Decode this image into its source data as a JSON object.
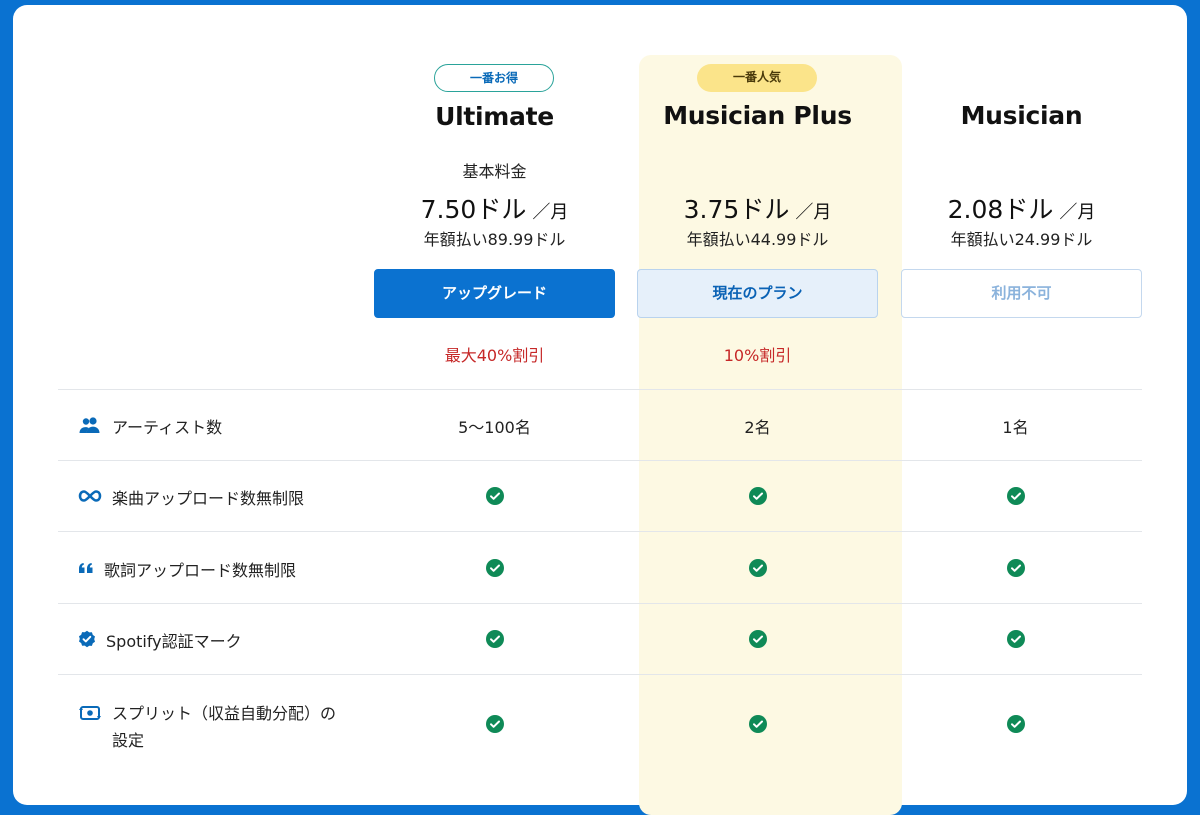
{
  "plans": [
    {
      "badge": "一番お得",
      "name": "Ultimate",
      "base_label": "基本料金",
      "price": "7.50ドル",
      "unit": "／月",
      "annual": "年額払い89.99ドル",
      "button": "アップグレード",
      "discount": "最大40%割引"
    },
    {
      "badge": "一番人気",
      "name": "Musician Plus",
      "base_label": "",
      "price": "3.75ドル",
      "unit": "／月",
      "annual": "年額払い44.99ドル",
      "button": "現在のプラン",
      "discount": "10%割引"
    },
    {
      "badge": "",
      "name": "Musician",
      "base_label": "",
      "price": "2.08ドル",
      "unit": "／月",
      "annual": "年額払い24.99ドル",
      "button": "利用不可",
      "discount": ""
    }
  ],
  "features": [
    {
      "icon": "users-icon",
      "label": "アーティスト数",
      "values": [
        "5〜100名",
        "2名",
        "1名"
      ]
    },
    {
      "icon": "infinity-icon",
      "label": "楽曲アップロード数無制限",
      "values": [
        "check",
        "check",
        "check"
      ]
    },
    {
      "icon": "quote-icon",
      "label": "歌詞アップロード数無制限",
      "values": [
        "check",
        "check",
        "check"
      ]
    },
    {
      "icon": "verified-badge-icon",
      "label": "Spotify認証マーク",
      "values": [
        "check",
        "check",
        "check"
      ]
    },
    {
      "icon": "split-payment-icon",
      "label": "スプリット（収益自動分配）の設定",
      "label_line1": "スプリット（収益自動分配）の",
      "label_line2": "設定",
      "values": [
        "check",
        "check",
        "check"
      ]
    }
  ],
  "colors": {
    "frame": "#0a72d1",
    "primary_button": "#0b72d0",
    "highlight_column": "#fdf9e3",
    "discount_text": "#c62828",
    "check": "#0f8a57",
    "icon": "#0a6ab8"
  }
}
